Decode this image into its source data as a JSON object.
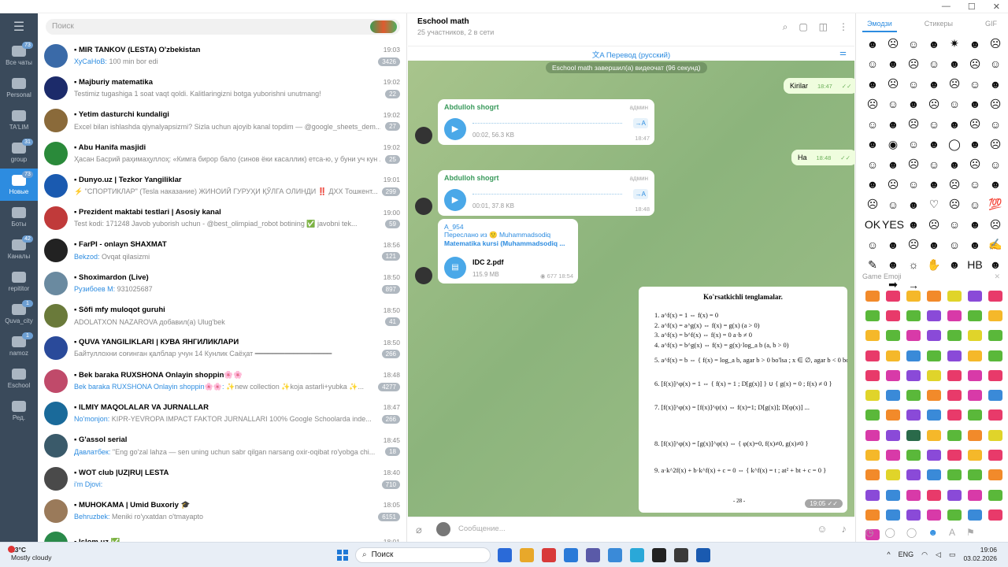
{
  "search": {
    "placeholder": "Поиск"
  },
  "rail": [
    {
      "label": "Все чаты",
      "badge": "73"
    },
    {
      "label": "Personal",
      "badge": ""
    },
    {
      "label": "TA'LIM",
      "badge": ""
    },
    {
      "label": "group",
      "badge": "31"
    },
    {
      "label": "Новые",
      "badge": "73"
    },
    {
      "label": "Боты",
      "badge": ""
    },
    {
      "label": "Каналы",
      "badge": "42"
    },
    {
      "label": "repititor",
      "badge": ""
    },
    {
      "label": "Quva_city",
      "badge": "1"
    },
    {
      "label": "namoz",
      "badge": "1"
    },
    {
      "label": "Eschool",
      "badge": ""
    },
    {
      "label": "Ред.",
      "badge": ""
    }
  ],
  "chats": [
    {
      "name": "MIR TANKOV (LESTA) O'zbekistan",
      "time": "19:03",
      "sender": "ХуСаНоВ",
      "preview": "100 min bor edi",
      "badge": "3426",
      "color": "#3a6aa8"
    },
    {
      "name": "Majburiy matematika",
      "time": "19:02",
      "sender": "",
      "preview": "Testimiz tugashiga 1 soat vaqt qoldi. Kalitlaringizni botga yuborishni unutmang!",
      "badge": "22",
      "color": "#1c2b6a"
    },
    {
      "name": "Yetim dasturchi kundaligi",
      "time": "19:02",
      "sender": "",
      "preview": "Excel bilan ishlashda qiynalyapsizmi? Sizla uchun ajoyib kanal topdim — @google_sheets_dem...",
      "badge": "27",
      "color": "#8a6a3a"
    },
    {
      "name": "Abu Hanifa masjidi",
      "time": "19:02",
      "sender": "",
      "preview": "Ҳасан Басрий раҳимаҳуллоҳ: «Кимга бирор бало (синов ёки касаллик) етса-ю, у буни уч кун ...",
      "badge": "25",
      "color": "#2a8a3a"
    },
    {
      "name": "Dunyo.uz | Tezkor Yangiliklar",
      "time": "19:01",
      "sender": "",
      "preview": "⚡ \"СПОРТИКЛАР\" (Tesla наказание) ЖИНОИЙ ГУРУҲИ ҚЎЛГА ОЛИНДИ ‼️ ДХХ Тошкент...",
      "badge": "299",
      "color": "#1a5ab0"
    },
    {
      "name": "Prezident maktabi testlari | Asosiy kanal",
      "time": "19:00",
      "sender": "",
      "preview": "Test kodi: 171248 Javob yuborish uchun - @best_olimpiad_robot botining ✅ javobni tek...",
      "badge": "59",
      "color": "#c03a3a"
    },
    {
      "name": "FarPI - onlayn SHAXMAT",
      "time": "18:56",
      "sender": "Bekzod",
      "preview": "Ovqat qilasizmi",
      "badge": "121",
      "color": "#222"
    },
    {
      "name": "Shoximardon (Live)",
      "time": "18:50",
      "sender": "Рузибоев М",
      "preview": "931025687",
      "badge": "897",
      "color": "#6a8aa0"
    },
    {
      "name": "Sôfi mfy muloqot guruhi",
      "time": "18:50",
      "sender": "",
      "preview": "ADOLATXON NAZAROVA добавил(а) Ulug'bek",
      "badge": "41",
      "color": "#6a7a3a"
    },
    {
      "name": "QUVA YANGILIKLARI | КУВА ЯНГИЛИКЛАРИ",
      "time": "18:50",
      "sender": "",
      "preview": "Байтуллохни соғинган қалблар учун 14 Кунлик Саёҳат ━━━━━━━━━━━━━━━━━━",
      "badge": "266",
      "color": "#2a4a9a"
    },
    {
      "name": "Bek baraka RUXSHONA Onlayin shoppin🌸🌸",
      "time": "18:48",
      "sender": "Bek baraka RUXSHONA Onlayin shoppin🌸🌸",
      "preview": "✨new collection ✨koja astarli+yubka ✨...",
      "badge": "4277",
      "color": "#c04a6a"
    },
    {
      "name": "ILMIY MAQOLALAR VA JURNALLAR",
      "time": "18:47",
      "sender": "No'monjon",
      "preview": "KIPR-YEVROPA IMPACT FAKTOR JURNALLARI 100% Google Schoolarda inde...",
      "badge": "266",
      "color": "#1a6a9a"
    },
    {
      "name": "G'assol serial",
      "time": "18:45",
      "sender": "Давлатбек",
      "preview": "\"Eng go'zal lahza — sen uning uchun sabr qilgan narsang oxir-oqibat ro'yobga chi...",
      "badge": "18",
      "color": "#3a5a6a"
    },
    {
      "name": "WOT club |UZ|RU| LESTA",
      "time": "18:40",
      "sender": "i'm Djovi",
      "preview": "",
      "badge": "710",
      "color": "#4a4a4a"
    },
    {
      "name": "MUHOKAMA | Umid Buxoriy 🎓",
      "time": "18:05",
      "sender": "Behruzbek",
      "preview": "Meniki ro'yxatdan o'tmayapto",
      "badge": "6151",
      "color": "#9a7a5a"
    },
    {
      "name": "Islom.uz ✅",
      "time": "18:01",
      "sender": "",
      "preview": "",
      "badge": "",
      "color": "#2a8a4a"
    }
  ],
  "chat": {
    "title": "Eschool math",
    "subtitle": "25 участников, 2 в сети",
    "translate": "Перевод (русский)",
    "service": "Eschool math завершил(а) видеочат (96 секунд)",
    "out1": {
      "text": "Kirilar",
      "time": "18:47"
    },
    "out2": {
      "text": "Ha",
      "time": "18:48"
    },
    "voice1": {
      "sender": "Abdulloh shogrt",
      "role": "админ",
      "meta": "00:02, 56.3 KB",
      "time": "18:47",
      "tr": "→A"
    },
    "voice2": {
      "sender": "Abdulloh shogrt",
      "role": "админ",
      "meta": "00:01, 37.8 KB",
      "time": "18:48",
      "tr": "→A"
    },
    "doc": {
      "sender": "A_954",
      "fwd1": "Переслано из 🙂 Muhammadsodiq",
      "fwd2": "Matematika kursi (Muhammadsodiq ...",
      "name": "IDC 2.pdf",
      "size": "115.9 MB",
      "views": "677",
      "time": "18:54"
    },
    "photo": {
      "title": "Ko'rsatkichli tenglamalar.",
      "lines": [
        "1.   a^f(x) = 1  ⇔  f(x) = 0",
        "2.   a^f(x) = a^g(x)  ⇔  f(x) = g(x)    (a > 0)",
        "3.   a^f(x) = b^f(x)  ⇔  f(x) = 0     a·b ≠ 0",
        "4.   a^f(x) = b^g(x)  ⇔  f(x) = g(x)·log_a b    (a, b > 0)",
        "5.   a^f(x) = b  ⇔  { f(x) = log_a b,   agar b > 0 bo'lsa ;  x ∈ ∅,   agar b < 0 bo'lsa }",
        "6.   [f(x)]^φ(x) = 1  ⇔  { f(x) = 1 ; D[g(x)] }  ∪  { g(x) = 0 ; f(x) ≠ 0 }",
        "7.   [f(x)]^φ(x) = [f(x)]^ψ(x)  ⇔  f(x)=1; D[g(x)]; D[φ(x)] ...",
        "8.   [f(x)]^φ(x) = [g(x)]^φ(x)  ⇔  { φ(x)=0, f(x)≠0, g(x)≠0 }",
        "9.   a·k^2f(x) + b·k^f(x) + c = 0  ⇔  { k^f(x) = t ;  at² + bt + c = 0 }"
      ],
      "page": "- 28 -",
      "time": "19:05"
    },
    "composer_placeholder": "Сообщение..."
  },
  "emoji": {
    "tabs": [
      "Эмодзи",
      "Стикеры",
      "GIF"
    ],
    "glyphs": [
      "☻",
      "☹",
      "☺",
      "☻",
      "✷",
      "☻",
      "☹",
      "☺",
      "☻",
      "☹",
      "☺",
      "☻",
      "☹",
      "☺",
      "☻",
      "☹",
      "☺",
      "☻",
      "☹",
      "☺",
      "☻",
      "☹",
      "☺",
      "☻",
      "☹",
      "☺",
      "☻",
      "☹",
      "☺",
      "☻",
      "☹",
      "☺",
      "☻",
      "☹",
      "☺",
      "☻",
      "◉",
      "☺",
      "☻",
      "◯",
      "☻",
      "☹",
      "☺",
      "☻",
      "☹",
      "☺",
      "☻",
      "☹",
      "☺",
      "☻",
      "☹",
      "☺",
      "☻",
      "☹",
      "☺",
      "☻",
      "☹",
      "☺",
      "☻",
      "♡",
      "☹",
      "☺",
      "💯",
      "OK",
      "YES",
      "☻",
      "☹",
      "☺",
      "☻",
      "☹",
      "☺",
      "☻",
      "☹",
      "☻",
      "☺",
      "☻",
      "✍",
      "✎",
      "☻",
      "☼",
      "✋",
      "☻",
      "HB",
      "☻",
      "",
      "➡",
      "→"
    ],
    "game_header": "Game Emoji",
    "game_colors": [
      "#f28a2a",
      "#e83a6a",
      "#f5b82a",
      "#f28a2a",
      "#e0d42a",
      "#8a4ad8",
      "#e83a6a",
      "#5ab83a",
      "#e83a6a",
      "#5ab83a",
      "#8a4ad8",
      "#d83aa8",
      "#5ab83a",
      "#f5b82a",
      "#f5b82a",
      "#5ab83a",
      "#d83aa8",
      "#8a4ad8",
      "#5ab83a",
      "#e0d42a",
      "#5ab83a",
      "#e83a6a",
      "#f5b82a",
      "#3a8ad8",
      "#5ab83a",
      "#8a4ad8",
      "#f5b82a",
      "#5ab83a",
      "#e83a6a",
      "#d83aa8",
      "#8a4ad8",
      "#e0d42a",
      "#e83a6a",
      "#d83aa8",
      "#e83a6a",
      "#e0d42a",
      "#3a8ad8",
      "#5ab83a",
      "#f28a2a",
      "#e83a6a",
      "#d83aa8",
      "#3a8ad8",
      "#5ab83a",
      "#f28a2a",
      "#8a4ad8",
      "#3a8ad8",
      "#e83a6a",
      "#5ab83a",
      "#e83a6a",
      "#d83aa8",
      "#8a4ad8",
      "#2a6a4a",
      "#f5b82a",
      "#5ab83a",
      "#f28a2a",
      "#e0d42a",
      "#f5b82a",
      "#d83aa8",
      "#5ab83a",
      "#8a4ad8",
      "#e83a6a",
      "#f5b82a",
      "#e83a6a",
      "#f28a2a",
      "#e0d42a",
      "#8a4ad8",
      "#3a8ad8",
      "#5ab83a",
      "#5ab83a",
      "#f28a2a",
      "#8a4ad8",
      "#3a8ad8",
      "#d83aa8",
      "#e83a6a",
      "#8a4ad8",
      "#d83aa8",
      "#5ab83a",
      "#f28a2a",
      "#3a8ad8",
      "#8a4ad8",
      "#d83aa8",
      "#5ab83a",
      "#3a8ad8",
      "#e83a6a",
      "#d83aa8"
    ]
  },
  "taskbar": {
    "temp": "13°C",
    "weather": "Mostly cloudy",
    "search": "Поиск",
    "lang": "ENG",
    "time": "19:06",
    "date": "03.02.2026",
    "apps": [
      "#2a6ad8",
      "#e8a82a",
      "#d83a3a",
      "#2a7ad8",
      "#5a5aa8",
      "#3a8ad8",
      "#2aa8d8",
      "#222",
      "#3a3a3a",
      "#1a5ab0"
    ]
  }
}
